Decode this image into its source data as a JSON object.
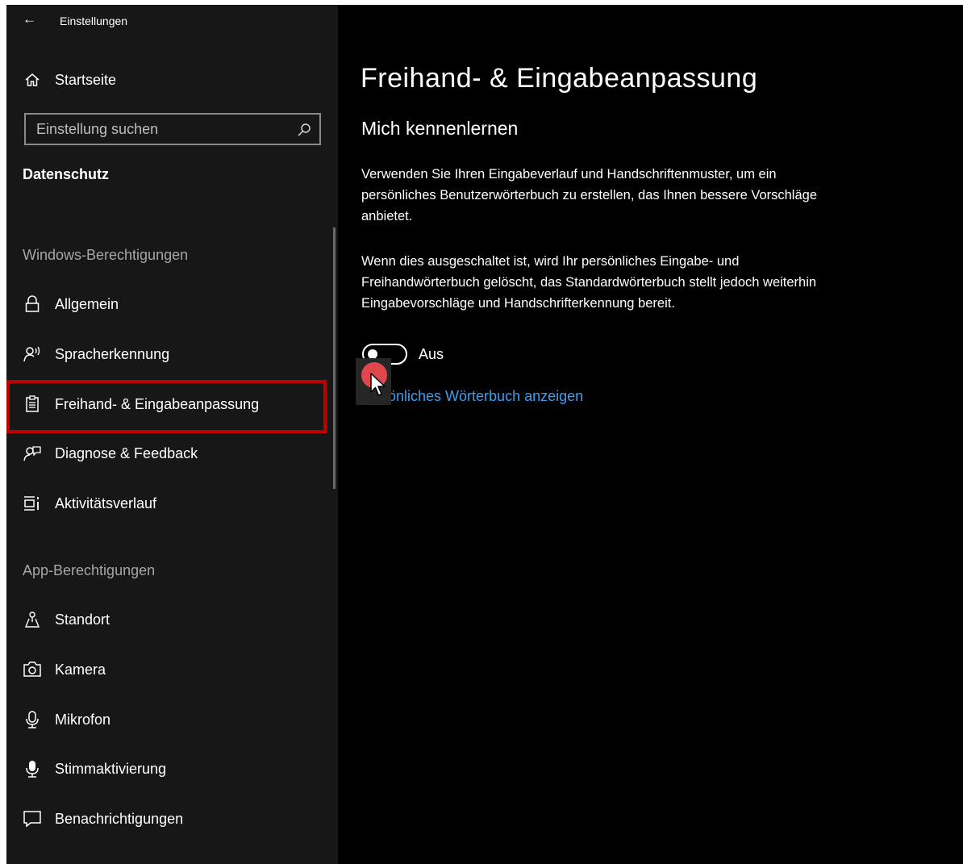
{
  "window": {
    "title": "Einstellungen",
    "back_icon": "back-arrow-icon"
  },
  "sidebar": {
    "home_label": "Startseite",
    "search_placeholder": "Einstellung suchen",
    "section_title": "Datenschutz",
    "group_windows": "Windows-Berechtigungen",
    "group_apps": "App-Berechtigungen",
    "items": [
      {
        "label": "Allgemein",
        "icon": "lock-icon"
      },
      {
        "label": "Spracherkennung",
        "icon": "speech-icon"
      },
      {
        "label": "Freihand- & Eingabeanpassung",
        "icon": "clipboard-icon",
        "selected": true
      },
      {
        "label": "Diagnose & Feedback",
        "icon": "feedback-icon"
      },
      {
        "label": "Aktivitätsverlauf",
        "icon": "timeline-icon"
      },
      {
        "label": "Standort",
        "icon": "location-icon"
      },
      {
        "label": "Kamera",
        "icon": "camera-icon"
      },
      {
        "label": "Mikrofon",
        "icon": "microphone-icon"
      },
      {
        "label": "Stimmaktivierung",
        "icon": "voice-activation-icon"
      },
      {
        "label": "Benachrichtigungen",
        "icon": "notification-icon"
      }
    ],
    "highlight_color": "#c00000"
  },
  "main": {
    "title": "Freihand- & Eingabeanpassung",
    "subtitle": "Mich kennenlernen",
    "para1": "Verwenden Sie Ihren Eingabeverlauf und Handschriftenmuster, um ein persönliches Benutzerwörterbuch zu erstellen, das Ihnen bessere Vorschläge anbietet.",
    "para2": "Wenn dies ausgeschaltet ist, wird Ihr persönliches Eingabe- und Freihandwörterbuch gelöscht, das Standardwörterbuch stellt jedoch weiterhin Eingabevorschläge und Handschrifterkennung bereit.",
    "toggle_state": "Aus",
    "link_text": "önliches Wörterbuch anzeigen",
    "link_color": "#3aa0f3"
  }
}
